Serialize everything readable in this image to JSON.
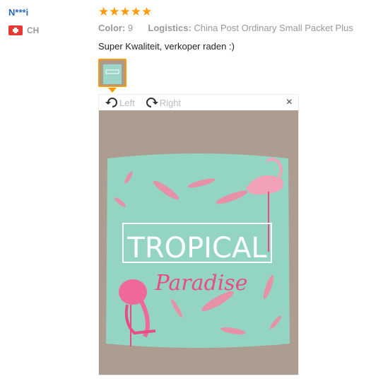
{
  "reviewer": {
    "name": "N***i",
    "country_code": "CH",
    "flag_icon": "swiss-flag-icon"
  },
  "rating": {
    "value": 5,
    "max": 5,
    "color": "#ff9900"
  },
  "details": {
    "color_label": "Color:",
    "color_value": "9",
    "logistics_label": "Logistics:",
    "logistics_value": "China Post Ordinary Small Packet Plus"
  },
  "review_text": "Super Kwaliteit, verkoper raden :)",
  "viewer": {
    "rotate_left_label": "Left",
    "rotate_right_label": "Right",
    "close_symbol": "×",
    "photo_title": "TROPICAL",
    "photo_subtitle": "Paradise"
  },
  "colors": {
    "link": "#2a69b8",
    "muted": "#999999",
    "accent": "#ff9900",
    "pillow": "#8fd3c0",
    "pink": "#e94c83"
  }
}
